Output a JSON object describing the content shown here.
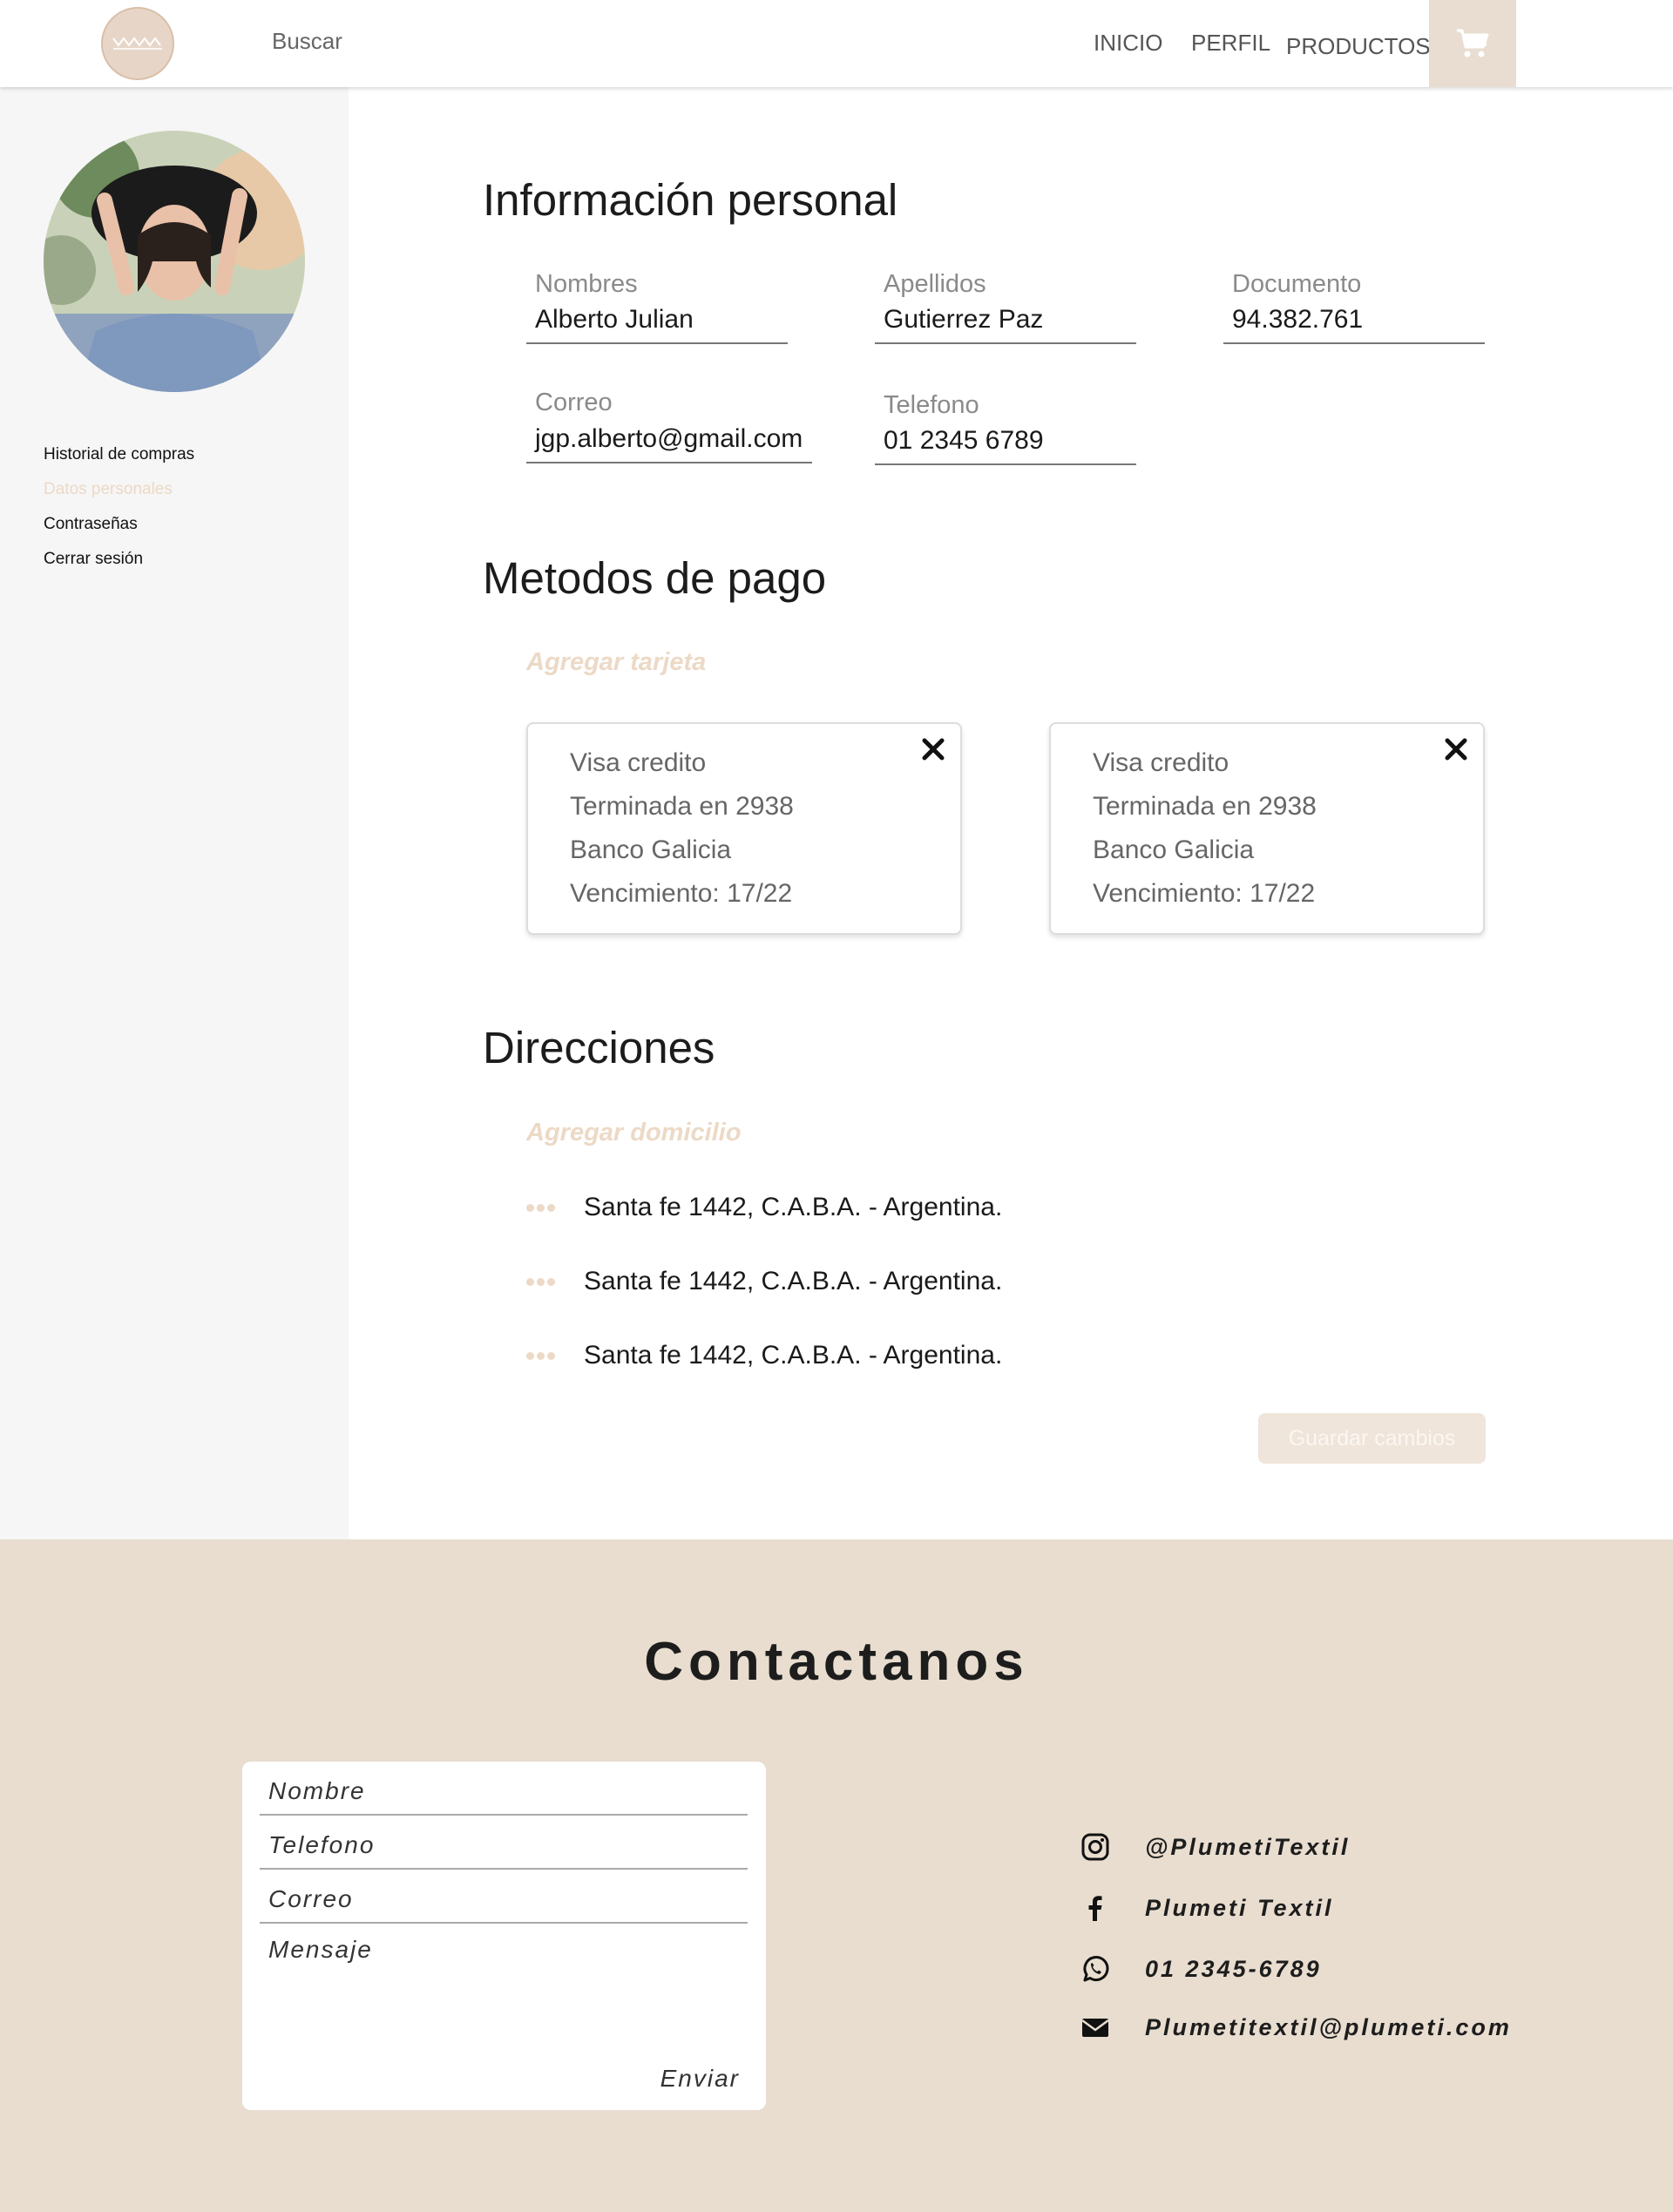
{
  "header": {
    "search_label": "Buscar",
    "nav": {
      "inicio": "INICIO",
      "perfil": "PERFIL",
      "productos": "PRODUCTOS"
    }
  },
  "sidebar": {
    "items": [
      {
        "label": "Historial de compras",
        "active": false
      },
      {
        "label": "Datos personales",
        "active": true
      },
      {
        "label": "Contraseñas",
        "active": false
      },
      {
        "label": "Cerrar sesión",
        "active": false
      }
    ]
  },
  "personal": {
    "title": "Información personal",
    "nombres_label": "Nombres",
    "nombres_value": "Alberto Julian",
    "apellidos_label": "Apellidos",
    "apellidos_value": "Gutierrez Paz",
    "documento_label": "Documento",
    "documento_value": "94.382.761",
    "correo_label": "Correo",
    "correo_value": "jgp.alberto@gmail.com",
    "telefono_label": "Telefono",
    "telefono_value": "01 2345 6789"
  },
  "payment": {
    "title": "Metodos de pago",
    "add_label": "Agregar tarjeta",
    "cards": [
      {
        "type": "Visa credito",
        "ending": "Terminada en 2938",
        "bank": "Banco Galicia",
        "expiry": "Vencimiento: 17/22"
      },
      {
        "type": "Visa credito",
        "ending": "Terminada en 2938",
        "bank": "Banco Galicia",
        "expiry": "Vencimiento: 17/22"
      }
    ]
  },
  "addresses": {
    "title": "Direcciones",
    "add_label": "Agregar domicilio",
    "items": [
      "Santa fe 1442, C.A.B.A. - Argentina.",
      "Santa fe 1442, C.A.B.A. - Argentina.",
      "Santa fe 1442, C.A.B.A. - Argentina."
    ]
  },
  "save_label": "Guardar cambios",
  "contact": {
    "title": "Contactanos",
    "form": {
      "nombre": "Nombre",
      "telefono": "Telefono",
      "correo": "Correo",
      "mensaje": "Mensaje",
      "send": "Enviar"
    },
    "social": {
      "instagram": "@PlumetiTextil",
      "facebook": "Plumeti Textil",
      "whatsapp": "01 2345-6789",
      "email": "Plumetitextil@plumeti.com"
    }
  },
  "colors": {
    "accent": "#e8ddcf",
    "accent_text": "#ecd9c6",
    "sidebar_bg": "#f6f6f6"
  },
  "icons": [
    "logo-icon",
    "cart-icon",
    "close-icon",
    "dots-icon",
    "instagram-icon",
    "facebook-icon",
    "whatsapp-icon",
    "mail-icon"
  ]
}
